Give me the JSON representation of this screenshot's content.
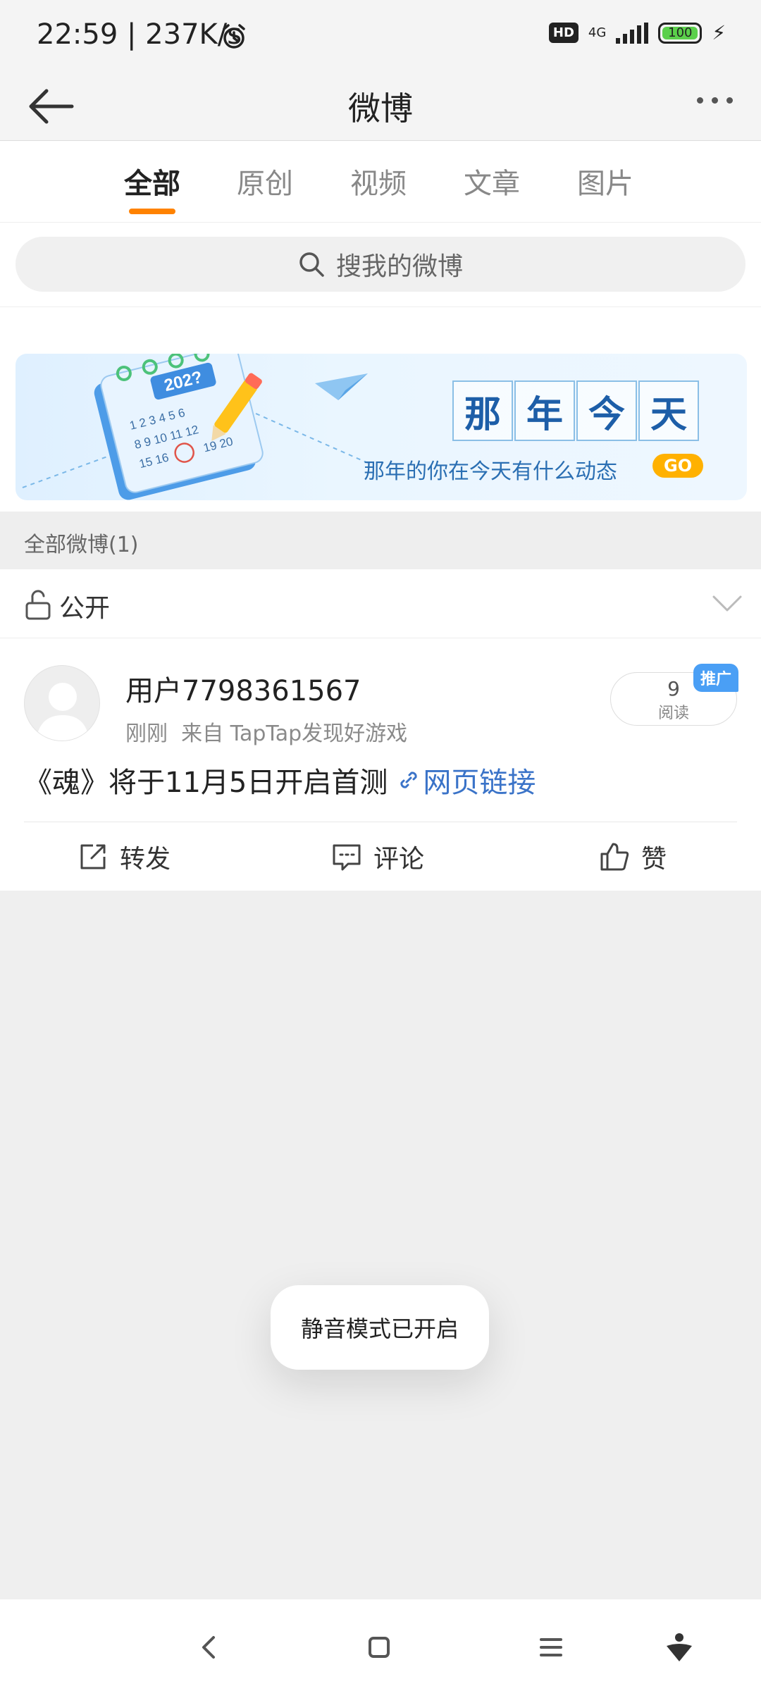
{
  "status_bar": {
    "time": "22:59 | 237K/s",
    "hd_badge": "HD",
    "network": "4G",
    "battery_level": "100"
  },
  "header": {
    "title": "微博"
  },
  "tabs": [
    {
      "label": "全部",
      "active": true
    },
    {
      "label": "原创",
      "active": false
    },
    {
      "label": "视频",
      "active": false
    },
    {
      "label": "文章",
      "active": false
    },
    {
      "label": "图片",
      "active": false
    }
  ],
  "search": {
    "placeholder": "搜我的微博"
  },
  "banner": {
    "title_chars": [
      "那",
      "年",
      "今",
      "天"
    ],
    "subtitle": "那年的你在今天有什么动态",
    "go_label": "GO",
    "calendar_year": "202?"
  },
  "section": {
    "label": "全部微博(1)"
  },
  "privacy": {
    "label": "公开"
  },
  "post": {
    "username": "用户7798361567",
    "meta": "刚刚  来自 TapTap发现好游戏",
    "read_count": "9",
    "read_label": "阅读",
    "promo_badge": "推广",
    "content": "《魂》将于11月5日开启首测",
    "link_text": "网页链接",
    "actions": {
      "repost": "转发",
      "comment": "评论",
      "like": "赞"
    }
  },
  "toast": {
    "message": "静音模式已开启"
  },
  "colors": {
    "accent": "#ff8200",
    "link": "#3a73c8",
    "promo": "#4a9ff5",
    "battery": "#5bd04b"
  }
}
